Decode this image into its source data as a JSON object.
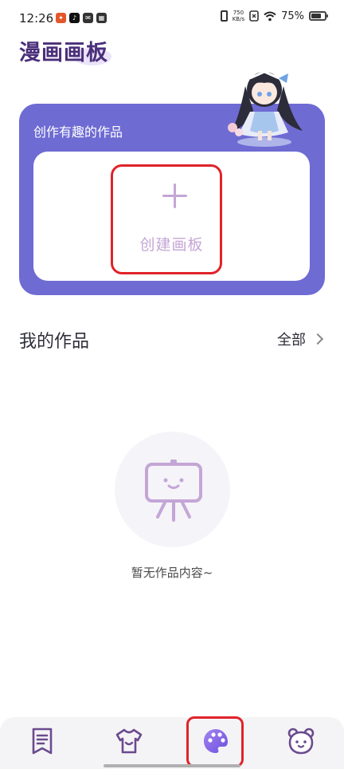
{
  "status_bar": {
    "time": "12:26",
    "speed_value": "750",
    "speed_unit": "KB/s",
    "battery": "75%",
    "battery_level": 0.75
  },
  "app": {
    "title": "漫画画板"
  },
  "hero": {
    "label": "创作有趣的作品",
    "create_label": "创建画板"
  },
  "works": {
    "title": "我的作品",
    "all_label": "全部",
    "empty_text": "暂无作品内容~"
  },
  "bottom_nav": {
    "items": [
      "book-icon",
      "shirt-icon",
      "palette-icon",
      "bear-icon"
    ],
    "active": "palette-icon"
  },
  "colors": {
    "accent": "#6e6bd3",
    "icon": "#6b4a8f",
    "create": "#c4a6d6",
    "highlight": "#e0232a"
  }
}
